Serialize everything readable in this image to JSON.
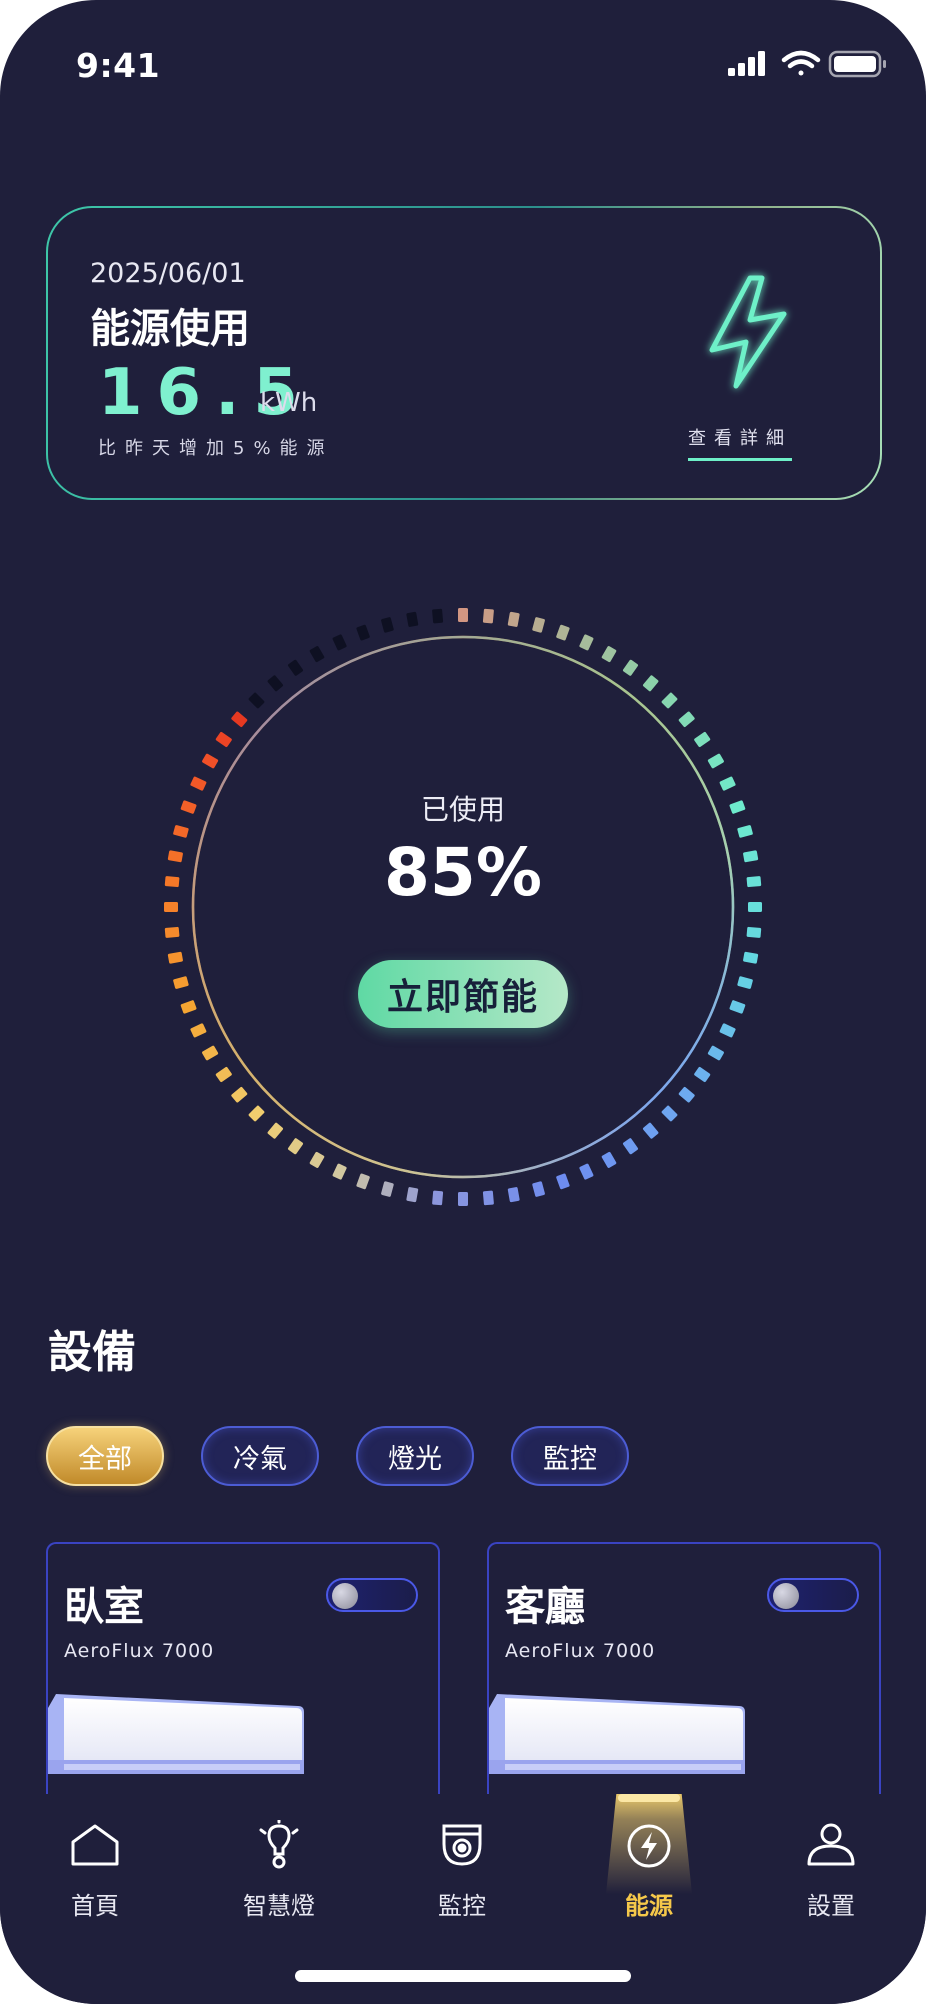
{
  "status_bar": {
    "time": "9:41",
    "icons": [
      "cellular-icon",
      "wifi-icon",
      "battery-icon"
    ]
  },
  "energy_card": {
    "date": "2025/06/01",
    "title": "能源使用",
    "value": "16.5",
    "unit": "kWh",
    "comparison": "比昨天增加5%能源",
    "details_link": "查看詳細",
    "icon": "lightning-bolt-icon",
    "accent_color": "#7ff0cf"
  },
  "usage_gauge": {
    "label": "已使用",
    "value": "85%",
    "percent": 85,
    "save_button": "立即節能",
    "colors": [
      "#2a2d48",
      "#e8442c",
      "#f39a2a",
      "#e9c46a",
      "#8fa0d8",
      "#6b86f0",
      "#6fe6d8",
      "#8fe0b0"
    ]
  },
  "devices": {
    "title": "設備",
    "filters": [
      {
        "label": "全部",
        "active": true
      },
      {
        "label": "冷氣",
        "active": false
      },
      {
        "label": "燈光",
        "active": false
      },
      {
        "label": "監控",
        "active": false
      }
    ],
    "cards": [
      {
        "name": "臥室",
        "model": "AeroFlux 7000",
        "on": false
      },
      {
        "name": "客廳",
        "model": "AeroFlux 7000",
        "on": false
      }
    ]
  },
  "bottom_nav": {
    "items": [
      {
        "label": "首頁",
        "icon": "home-icon",
        "active": false
      },
      {
        "label": "智慧燈",
        "icon": "bulb-icon",
        "active": false
      },
      {
        "label": "監控",
        "icon": "camera-icon",
        "active": false
      },
      {
        "label": "能源",
        "icon": "energy-icon",
        "active": true
      },
      {
        "label": "設置",
        "icon": "user-icon",
        "active": false
      }
    ],
    "active_color": "#f5c84a"
  }
}
